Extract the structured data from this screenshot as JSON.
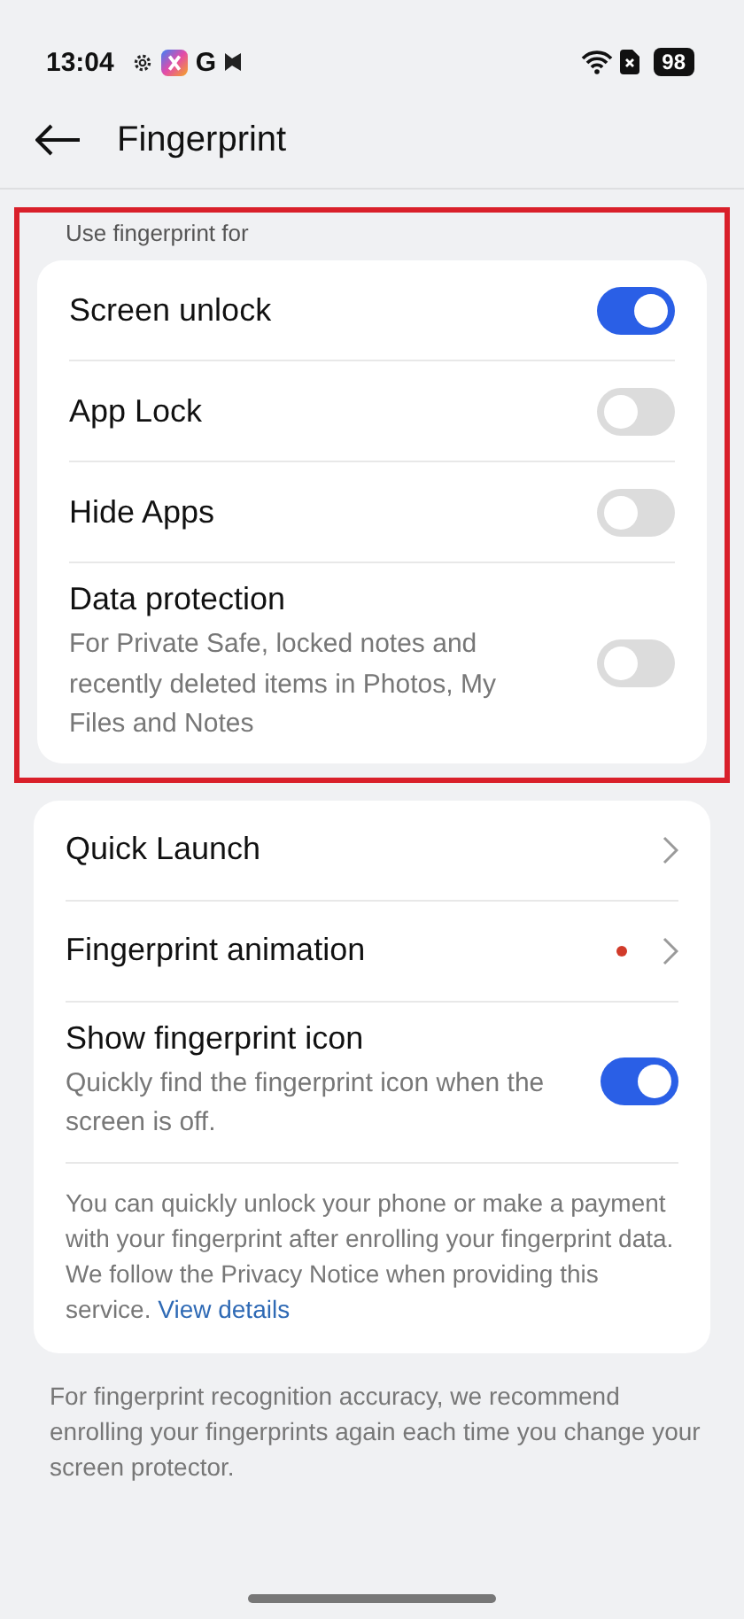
{
  "status_bar": {
    "time": "13:04",
    "notification_letter": "G",
    "battery": "98"
  },
  "header": {
    "title": "Fingerprint"
  },
  "section": {
    "label": "Use fingerprint for",
    "highlighted": true,
    "rows": [
      {
        "kind": "toggle",
        "title": "Screen unlock",
        "on": true
      },
      {
        "kind": "toggle",
        "title": "App Lock",
        "on": false
      },
      {
        "kind": "toggle",
        "title": "Hide Apps",
        "on": false
      },
      {
        "kind": "toggle",
        "title": "Data protection",
        "subtitle": "For Private Safe, locked notes and recently deleted items in Photos, My Files and Notes",
        "on": false
      }
    ]
  },
  "card": {
    "rows": [
      {
        "kind": "link",
        "title": "Quick Launch",
        "new": false
      },
      {
        "kind": "link",
        "title": "Fingerprint animation",
        "new": true
      },
      {
        "kind": "toggle",
        "title": "Show fingerprint icon",
        "subtitle": "Quickly find the fingerprint icon when the screen is off.",
        "on": true
      }
    ],
    "note": {
      "text": "You can quickly unlock your phone or make a payment with your fingerprint after enrolling your fingerprint data. We follow the Privacy Notice when providing this service.",
      "link": "View details"
    }
  },
  "footer_note": "For fingerprint recognition accuracy, we recommend enrolling your fingerprints again each time you change your screen protector."
}
